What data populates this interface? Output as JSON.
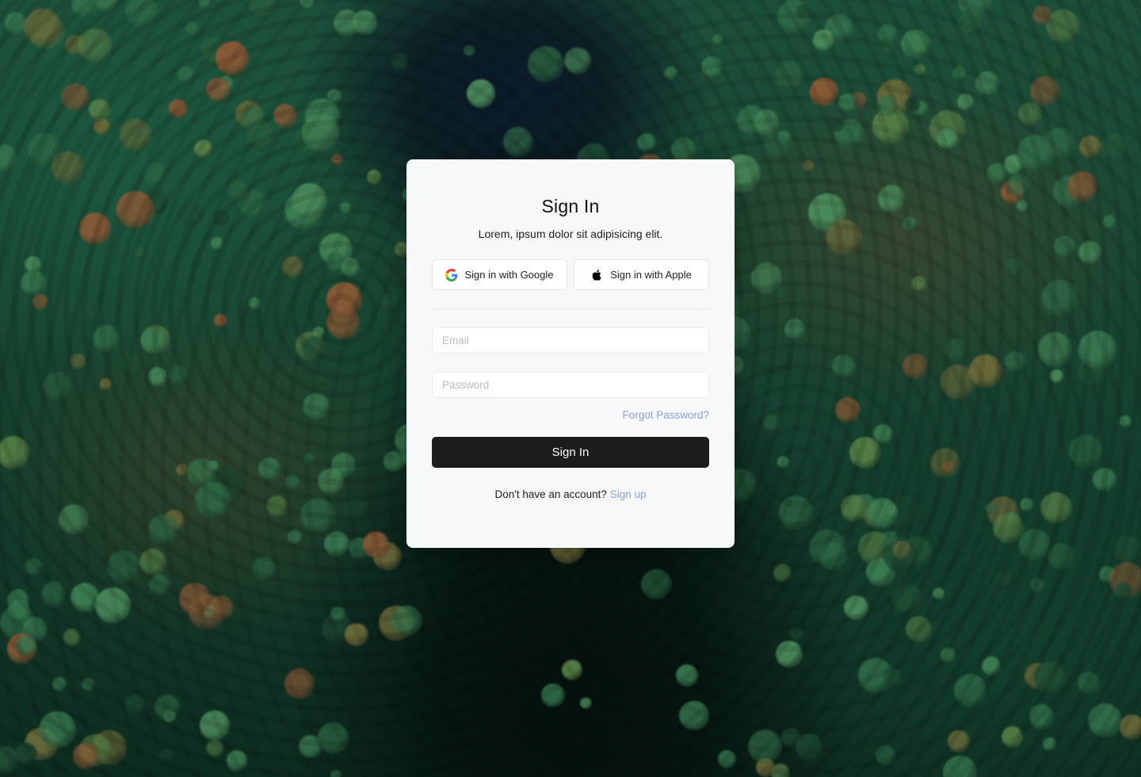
{
  "card": {
    "title": "Sign In",
    "subtitle": "Lorem, ipsum dolor sit adipisicing elit."
  },
  "social": {
    "google": {
      "label": "Sign in with Google",
      "icon": "google-icon"
    },
    "apple": {
      "label": "Sign in with Apple",
      "icon": "apple-icon"
    }
  },
  "form": {
    "email": {
      "placeholder": "Email",
      "value": ""
    },
    "password": {
      "placeholder": "Password",
      "value": ""
    },
    "forgot_label": "Forgot Password?",
    "submit_label": "Sign In"
  },
  "footer": {
    "prompt": "Don't have an account?",
    "signup_label": "Sign up"
  },
  "colors": {
    "card_bg": "#f7f8fa",
    "primary_button": "#1c1c1c",
    "link": "#8c9fe8"
  }
}
